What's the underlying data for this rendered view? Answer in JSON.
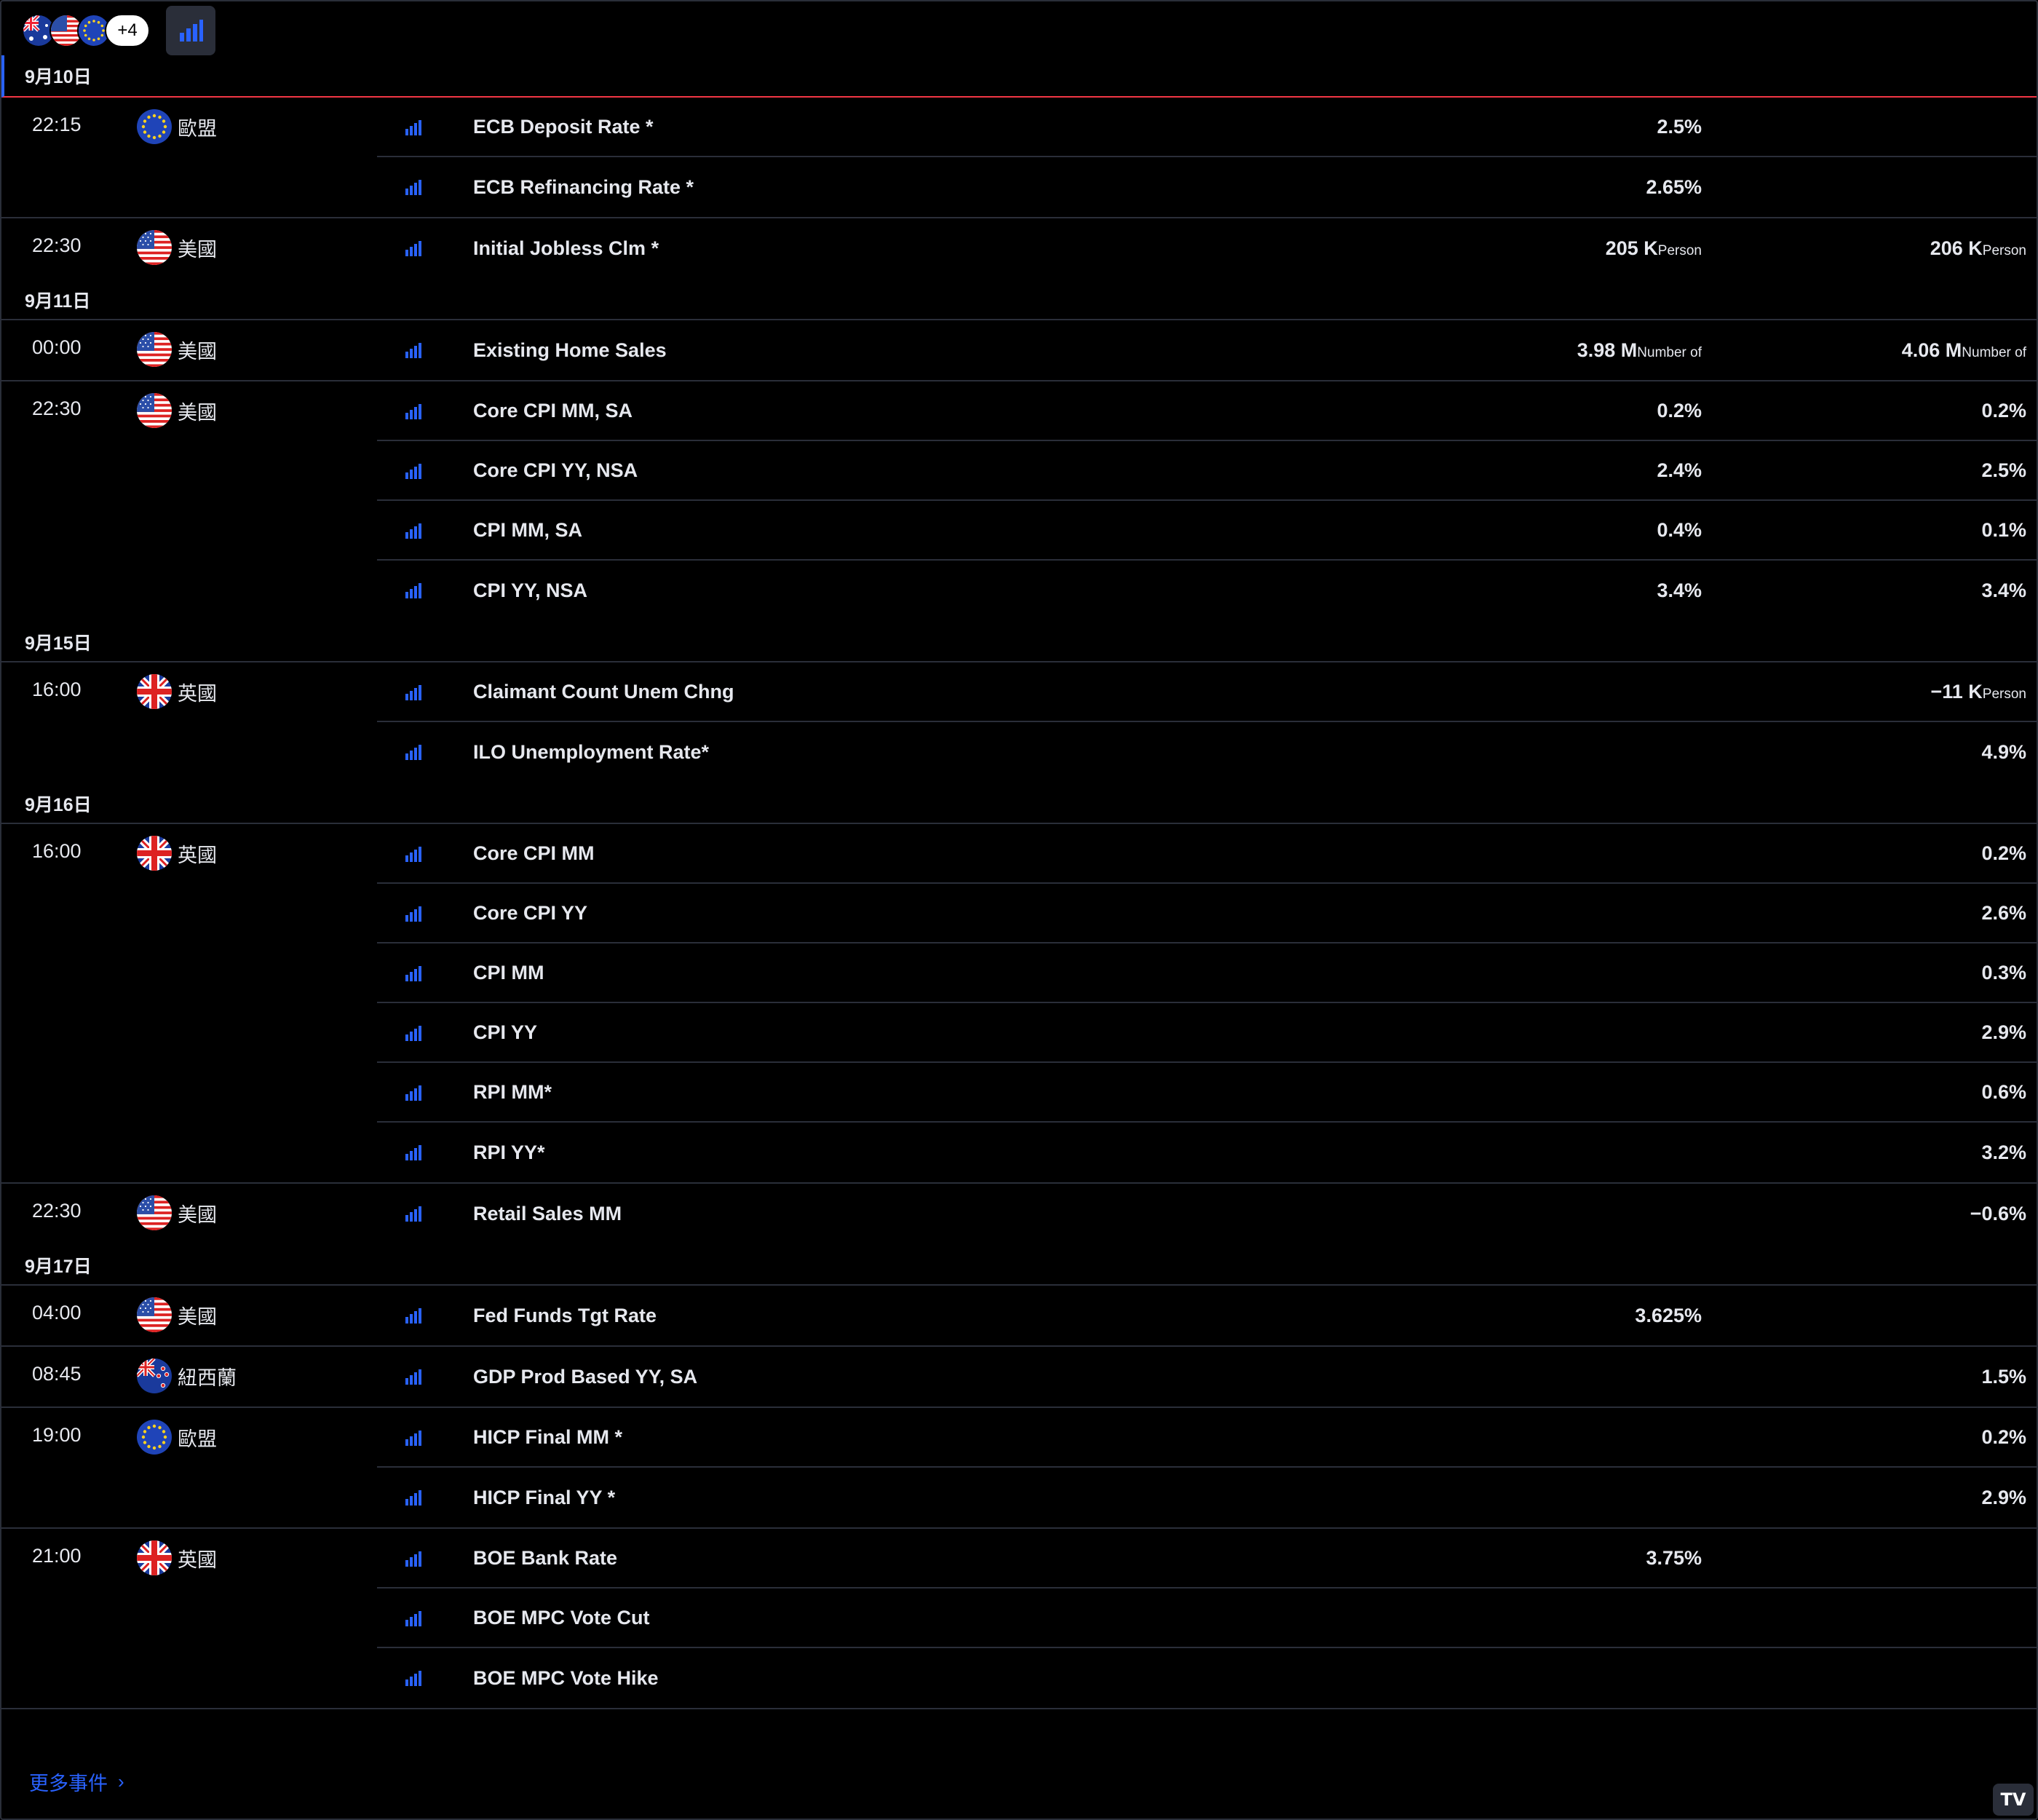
{
  "filter": {
    "more_count": "+4"
  },
  "footer": {
    "more_events": "更多事件",
    "logo_text": "TV"
  },
  "colors": {
    "accent": "#2962ff",
    "today_line": "#f23645",
    "importance": "#2962ff"
  },
  "days": [
    {
      "date": "9月10日",
      "groups": [
        {
          "time": "22:15",
          "flag": "eu",
          "country": "歐盟",
          "events": [
            {
              "name": "ECB Deposit Rate *",
              "forecast": "2.5%",
              "prior": ""
            },
            {
              "name": "ECB Refinancing Rate *",
              "forecast": "2.65%",
              "prior": ""
            }
          ]
        },
        {
          "time": "22:30",
          "flag": "us",
          "country": "美國",
          "noborder": true,
          "events": [
            {
              "name": "Initial Jobless Clm *",
              "forecast": "205 K",
              "forecast_unit": "Person",
              "prior": "206 K",
              "prior_unit": "Person"
            }
          ]
        }
      ]
    },
    {
      "date": "9月11日",
      "groups": [
        {
          "time": "00:00",
          "flag": "us",
          "country": "美國",
          "events": [
            {
              "name": "Existing Home Sales",
              "forecast": "3.98 M",
              "forecast_unit": "Number of",
              "prior": "4.06 M",
              "prior_unit": "Number of"
            }
          ]
        },
        {
          "time": "22:30",
          "flag": "us",
          "country": "美國",
          "noborder": true,
          "events": [
            {
              "name": "Core CPI MM, SA",
              "forecast": "0.2%",
              "prior": "0.2%"
            },
            {
              "name": "Core CPI YY, NSA",
              "forecast": "2.4%",
              "prior": "2.5%"
            },
            {
              "name": "CPI MM, SA",
              "forecast": "0.4%",
              "prior": "0.1%"
            },
            {
              "name": "CPI YY, NSA",
              "forecast": "3.4%",
              "prior": "3.4%"
            }
          ]
        }
      ]
    },
    {
      "date": "9月15日",
      "groups": [
        {
          "time": "16:00",
          "flag": "uk",
          "country": "英國",
          "noborder": true,
          "events": [
            {
              "name": "Claimant Count Unem Chng",
              "forecast": "",
              "prior": "−11 K",
              "prior_unit": "Person"
            },
            {
              "name": "ILO Unemployment Rate*",
              "forecast": "",
              "prior": "4.9%"
            }
          ]
        }
      ]
    },
    {
      "date": "9月16日",
      "groups": [
        {
          "time": "16:00",
          "flag": "uk",
          "country": "英國",
          "events": [
            {
              "name": "Core CPI MM",
              "forecast": "",
              "prior": "0.2%"
            },
            {
              "name": "Core CPI YY",
              "forecast": "",
              "prior": "2.6%"
            },
            {
              "name": "CPI MM",
              "forecast": "",
              "prior": "0.3%"
            },
            {
              "name": "CPI YY",
              "forecast": "",
              "prior": "2.9%"
            },
            {
              "name": "RPI MM*",
              "forecast": "",
              "prior": "0.6%"
            },
            {
              "name": "RPI YY*",
              "forecast": "",
              "prior": "3.2%"
            }
          ]
        },
        {
          "time": "22:30",
          "flag": "us",
          "country": "美國",
          "noborder": true,
          "events": [
            {
              "name": "Retail Sales MM",
              "forecast": "",
              "prior": "−0.6%"
            }
          ]
        }
      ]
    },
    {
      "date": "9月17日",
      "groups": [
        {
          "time": "04:00",
          "flag": "us",
          "country": "美國",
          "events": [
            {
              "name": "Fed Funds Tgt Rate",
              "forecast": "3.625%",
              "prior": ""
            }
          ]
        },
        {
          "time": "08:45",
          "flag": "nz",
          "country": "紐西蘭",
          "events": [
            {
              "name": "GDP Prod Based YY, SA",
              "forecast": "",
              "prior": "1.5%"
            }
          ]
        },
        {
          "time": "19:00",
          "flag": "eu",
          "country": "歐盟",
          "events": [
            {
              "name": "HICP Final MM *",
              "forecast": "",
              "prior": "0.2%"
            },
            {
              "name": "HICP Final YY *",
              "forecast": "",
              "prior": "2.9%"
            }
          ]
        },
        {
          "time": "21:00",
          "flag": "uk",
          "country": "英國",
          "events": [
            {
              "name": "BOE Bank Rate",
              "forecast": "3.75%",
              "prior": ""
            },
            {
              "name": "BOE MPC Vote Cut",
              "forecast": "",
              "prior": ""
            },
            {
              "name": "BOE MPC Vote Hike",
              "forecast": "",
              "prior": ""
            }
          ]
        }
      ]
    }
  ]
}
